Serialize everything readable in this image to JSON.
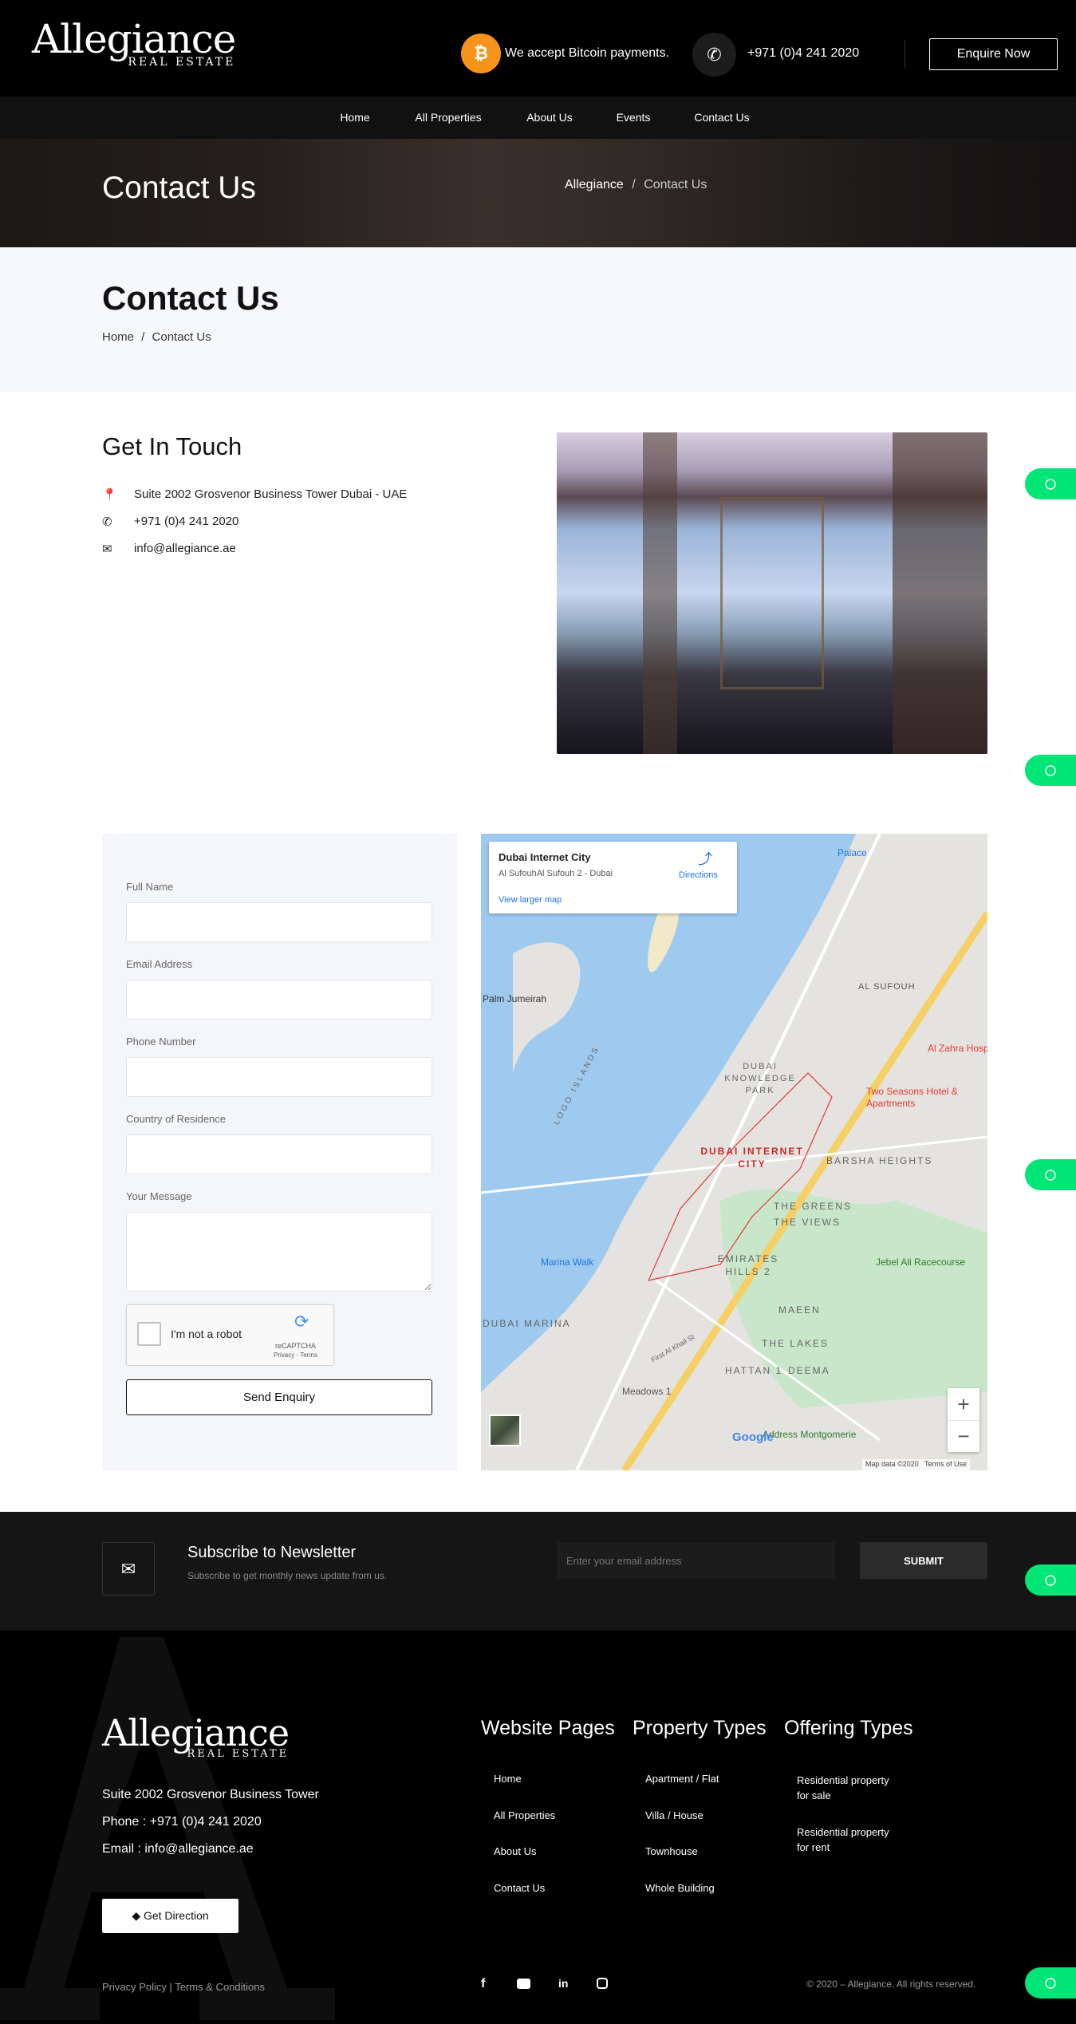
{
  "header": {
    "logo_main": "Allegiance",
    "logo_sub": "REAL ESTATE",
    "bitcoin_text": "We accept Bitcoin payments.",
    "phone": "+971 (0)4 241 2020",
    "enquire_label": "Enquire Now"
  },
  "nav": {
    "items": [
      "Home",
      "All Properties",
      "About Us",
      "Events",
      "Contact Us"
    ]
  },
  "hero": {
    "title": "Contact Us",
    "breadcrumb_root": "Allegiance",
    "breadcrumb_sep": "/",
    "breadcrumb_current": "Contact Us"
  },
  "page_header": {
    "title": "Contact Us",
    "breadcrumb_home": "Home",
    "breadcrumb_sep": "/",
    "breadcrumb_current": "Contact Us"
  },
  "contact": {
    "title": "Get In Touch",
    "address": "Suite 2002 Grosvenor Business Tower Dubai - UAE",
    "phone": "+971 (0)4 241 2020",
    "email": "info@allegiance.ae"
  },
  "form": {
    "fields": [
      "Full Name",
      "Email Address",
      "Phone Number",
      "Country of Residence"
    ],
    "message_label": "Your Message",
    "captcha_label": "I'm not a robot",
    "captcha_brand": "reCAPTCHA",
    "captcha_links": "Privacy - Terms",
    "submit_label": "Send Enquiry"
  },
  "map": {
    "place_name": "Dubai Internet City",
    "place_address": "Al SufouhAl Sufouh 2 - Dubai",
    "directions_label": "Directions",
    "larger_map_label": "View larger map",
    "labels": [
      "Palace",
      "Palm Jumeirah",
      "AL SUFOUH",
      "DUBAI KNOWLEDGE PARK",
      "Al Zahra Hospi",
      "Two Seasons Hotel & Apartments",
      "DUBAI INTERNET CITY",
      "BARSHA HEIGHTS",
      "THE GREENS",
      "THE VIEWS",
      "Marina Walk",
      "EMIRATES HILLS 2",
      "Jebel Ali Racecourse",
      "DUBAI MARINA",
      "MAEEN",
      "THE LAKES",
      "HATTAN 1",
      "DEEMA",
      "Meadows 1",
      "Address Montgomerie",
      "LOGO ISLANDS",
      "First Al Khail St"
    ],
    "attribution": "Map data ©2020",
    "terms": "Terms of Use",
    "google": "Google",
    "zoom_in": "+",
    "zoom_out": "−"
  },
  "newsletter": {
    "title": "Subscribe to Newsletter",
    "subtitle": "Subscribe to get monthly news update from us.",
    "placeholder": "Enter your email address",
    "submit_label": "SUBMIT"
  },
  "footer": {
    "address": "Suite 2002 Grosvenor Business Tower",
    "phone": "Phone : +971 (0)4 241 2020",
    "email": "Email : info@allegiance.ae",
    "direction_label": "Get Direction",
    "columns": [
      {
        "title": "Website Pages",
        "items": [
          "Home",
          "All Properties",
          "About Us",
          "Contact Us"
        ]
      },
      {
        "title": "Property Types",
        "items": [
          "Apartment / Flat",
          "Villa / House",
          "Townhouse",
          "Whole Building"
        ]
      },
      {
        "title": "Offering Types",
        "items": [
          "Residential property for sale",
          "Residential property for rent"
        ]
      }
    ],
    "legal": "Privacy Policy | Terms & Conditions",
    "copyright": "© 2020 – Allegiance. All rights reserved.",
    "social": [
      "facebook",
      "youtube",
      "linkedin",
      "instagram"
    ]
  },
  "colors": {
    "bitcoin": "#f7931a",
    "whatsapp": "#00e676",
    "header_bg": "#000000",
    "nav_bg": "#111111"
  }
}
